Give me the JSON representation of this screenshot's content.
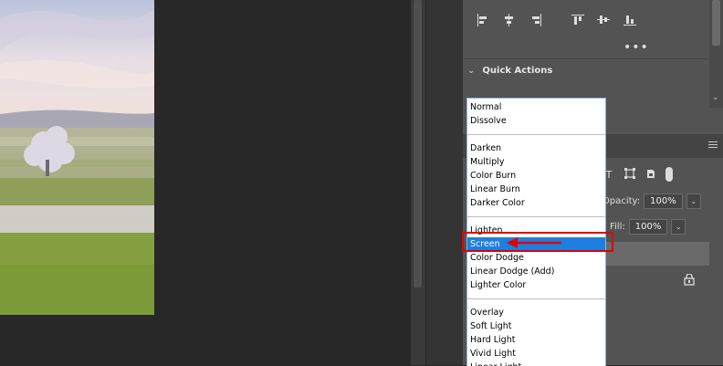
{
  "window": {
    "background": "#282828"
  },
  "canvas": {
    "image_icon": "landscape-photo"
  },
  "panel": {
    "align_icons": [
      "align-left-edges-icon",
      "align-horizontal-centers-icon",
      "align-right-edges-icon",
      "align-top-edges-icon",
      "align-vertical-centers-icon",
      "align-bottom-edges-icon"
    ],
    "more_label": "•••",
    "quick_actions_title": "Quick Actions"
  },
  "layers": {
    "opacity_label": "Opacity:",
    "opacity_value": "100%",
    "fill_label": "Fill:",
    "fill_value": "100%"
  },
  "blend_menu": {
    "groups": [
      [
        "Normal",
        "Dissolve"
      ],
      [
        "Darken",
        "Multiply",
        "Color Burn",
        "Linear Burn",
        "Darker Color"
      ],
      [
        "Lighten",
        "Screen",
        "Color Dodge",
        "Linear Dodge (Add)",
        "Lighter Color"
      ],
      [
        "Overlay",
        "Soft Light",
        "Hard Light",
        "Vivid Light",
        "Linear Light"
      ]
    ],
    "selected": "Screen",
    "highlight_color": "#1e7fe0"
  },
  "annotation": {
    "color": "#e00000"
  }
}
